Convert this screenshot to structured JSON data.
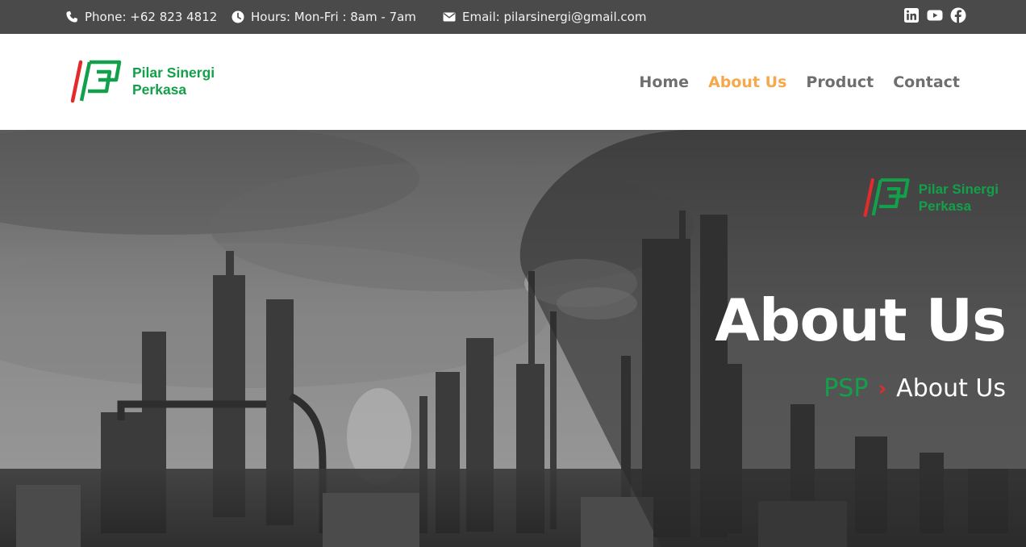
{
  "topbar": {
    "phone": "Phone: +62 823 4812",
    "hours": "Hours: Mon-Fri : 8am - 7am",
    "email": "Email: pilarsinergi@gmail.com",
    "social_icons": [
      "linkedin-icon",
      "youtube-icon",
      "facebook-icon"
    ]
  },
  "header": {
    "brand_line1": "Pilar Sinergi",
    "brand_line2": "Perkasa",
    "nav": [
      {
        "label": "Home",
        "active": false
      },
      {
        "label": "About Us",
        "active": true
      },
      {
        "label": "Product",
        "active": false
      },
      {
        "label": "Contact",
        "active": false
      }
    ]
  },
  "hero": {
    "brand_line1": "Pilar Sinergi",
    "brand_line2": "Perkasa",
    "title": "About Us",
    "breadcrumb_home": "PSP",
    "breadcrumb_separator": "›",
    "breadcrumb_current": "About Us"
  },
  "colors": {
    "topbar_bg": "#4a4a4a",
    "brand_green": "#12a04a",
    "brand_red": "#e32b2b",
    "nav_active": "#f5a94c",
    "nav_text": "#6e6e6e"
  }
}
